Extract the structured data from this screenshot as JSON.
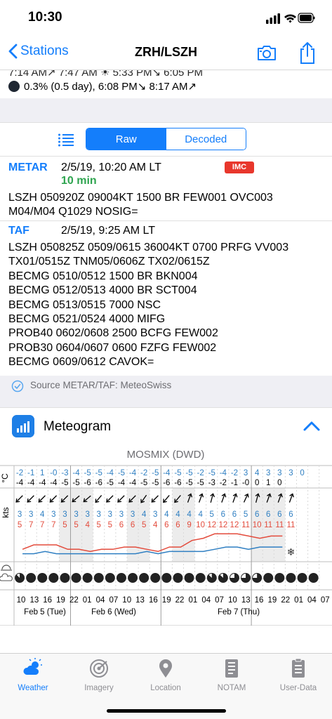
{
  "status_bar": {
    "time": "10:30"
  },
  "nav": {
    "back_label": "Stations",
    "title": "ZRH/LSZH"
  },
  "astro": {
    "sun_row": "7:14 AM↗ 7:47 AM ☀ 5:33 PM↘ 6:05 PM",
    "moon_row": "0.3% (0.5 day), 6:08 PM↘ 8:17 AM↗"
  },
  "view_toggle": {
    "options": [
      "Raw",
      "Decoded"
    ],
    "selected": "Raw"
  },
  "metar": {
    "tag": "METAR",
    "issued": "2/5/19, 10:20 AM LT",
    "age": "10 min",
    "category": "IMC",
    "text": [
      "LSZH 050920Z 09004KT 1500 BR FEW001 OVC003",
      "M04/M04 Q1029 NOSIG="
    ]
  },
  "taf": {
    "tag": "TAF",
    "issued": "2/5/19, 9:25 AM LT",
    "text": [
      "LSZH 050825Z 0509/0615 36004KT 0700 PRFG VV003",
      "TX01/0515Z TNM05/0606Z TX02/0615Z",
      "BECMG 0510/0512 1500 BR BKN004",
      "BECMG 0512/0513 4000 BR SCT004",
      "BECMG 0513/0515 7000 NSC",
      "BECMG 0521/0524 4000 MIFG",
      "PROB40 0602/0608 2500 BCFG FEW002",
      "PROB30 0604/0607 0600 FZFG FEW002",
      "BECMG 0609/0612 CAVOK="
    ]
  },
  "source": {
    "text": "Source METAR/TAF: MeteoSwiss"
  },
  "meteogram": {
    "title": "Meteogram",
    "model": "MOSMIX (DWD)",
    "temp_unit": "°C",
    "wind_unit": "kts",
    "dewpoint": [
      "-2",
      "-1",
      "1",
      "-0",
      "-3",
      "-4",
      "-5",
      "-5",
      "-4",
      "-5",
      "-4",
      "-2",
      "-5",
      "-4",
      "-5",
      "-5",
      "-2",
      "-5",
      "-4",
      "-2",
      "3",
      "4",
      "3",
      "3",
      "3",
      "0"
    ],
    "temperature": [
      "-4",
      "-4",
      "-4",
      "-4",
      "-5",
      "-5",
      "-6",
      "-6",
      "-5",
      "-4",
      "-4",
      "-5",
      "-5",
      "-6",
      "-6",
      "-5",
      "-5",
      "-3",
      "-2",
      "-1",
      "-0",
      "0",
      "1",
      "0"
    ],
    "wind_speed": [
      "3",
      "3",
      "4",
      "3",
      "3",
      "3",
      "3",
      "3",
      "3",
      "3",
      "3",
      "4",
      "3",
      "4",
      "4",
      "4",
      "4",
      "5",
      "6",
      "6",
      "5",
      "6",
      "6",
      "6",
      "6"
    ],
    "wind_gust": [
      "5",
      "7",
      "7",
      "7",
      "5",
      "5",
      "4",
      "5",
      "5",
      "6",
      "6",
      "5",
      "4",
      "6",
      "6",
      "9",
      "10",
      "12",
      "12",
      "12",
      "11",
      "10",
      "11",
      "11",
      "11"
    ],
    "hours": [
      "10",
      "13",
      "16",
      "19",
      "22",
      "01",
      "04",
      "07",
      "10",
      "13",
      "16",
      "19",
      "22",
      "01",
      "04",
      "07",
      "10",
      "13",
      "16",
      "19",
      "22",
      "01",
      "04",
      "07"
    ],
    "days": [
      "Feb 5 (Tue)",
      "Feb 6 (Wed)",
      "Feb 7 (Thu)"
    ]
  },
  "chart_data": {
    "type": "line",
    "title": "MOSMIX (DWD)",
    "ylabel": "kts",
    "x": [
      "10",
      "13",
      "16",
      "19",
      "22",
      "01",
      "04",
      "07",
      "10",
      "13",
      "16",
      "19",
      "22",
      "01",
      "04",
      "07",
      "10",
      "13",
      "16",
      "19",
      "22",
      "01",
      "04",
      "07"
    ],
    "series": [
      {
        "name": "",
        "color": "#e34b3c",
        "values": [
          5,
          7,
          7,
          7,
          5,
          5,
          4,
          5,
          5,
          6,
          6,
          5,
          4,
          6,
          6,
          9,
          10,
          12,
          12,
          12,
          11,
          10,
          11,
          11
        ]
      },
      {
        "name": "",
        "color": "#2f7fc2",
        "values": [
          3,
          3,
          4,
          3,
          3,
          3,
          3,
          3,
          3,
          3,
          3,
          4,
          3,
          4,
          4,
          4,
          4,
          5,
          6,
          6,
          5,
          6,
          6,
          6
        ]
      }
    ],
    "ylim": [
      0,
      14
    ]
  },
  "tabs": [
    {
      "label": "Weather",
      "icon": "weather-icon",
      "active": true
    },
    {
      "label": "Imagery",
      "icon": "imagery-icon",
      "active": false
    },
    {
      "label": "Location",
      "icon": "location-pin-icon",
      "active": false
    },
    {
      "label": "NOTAM",
      "icon": "notam-icon",
      "active": false
    },
    {
      "label": "User-Data",
      "icon": "user-data-icon",
      "active": false
    }
  ],
  "colors": {
    "accent": "#147efb",
    "imc": "#e8372c",
    "age": "#2ea44f",
    "gust": "#e34b3c",
    "wind": "#2f7fc2"
  }
}
